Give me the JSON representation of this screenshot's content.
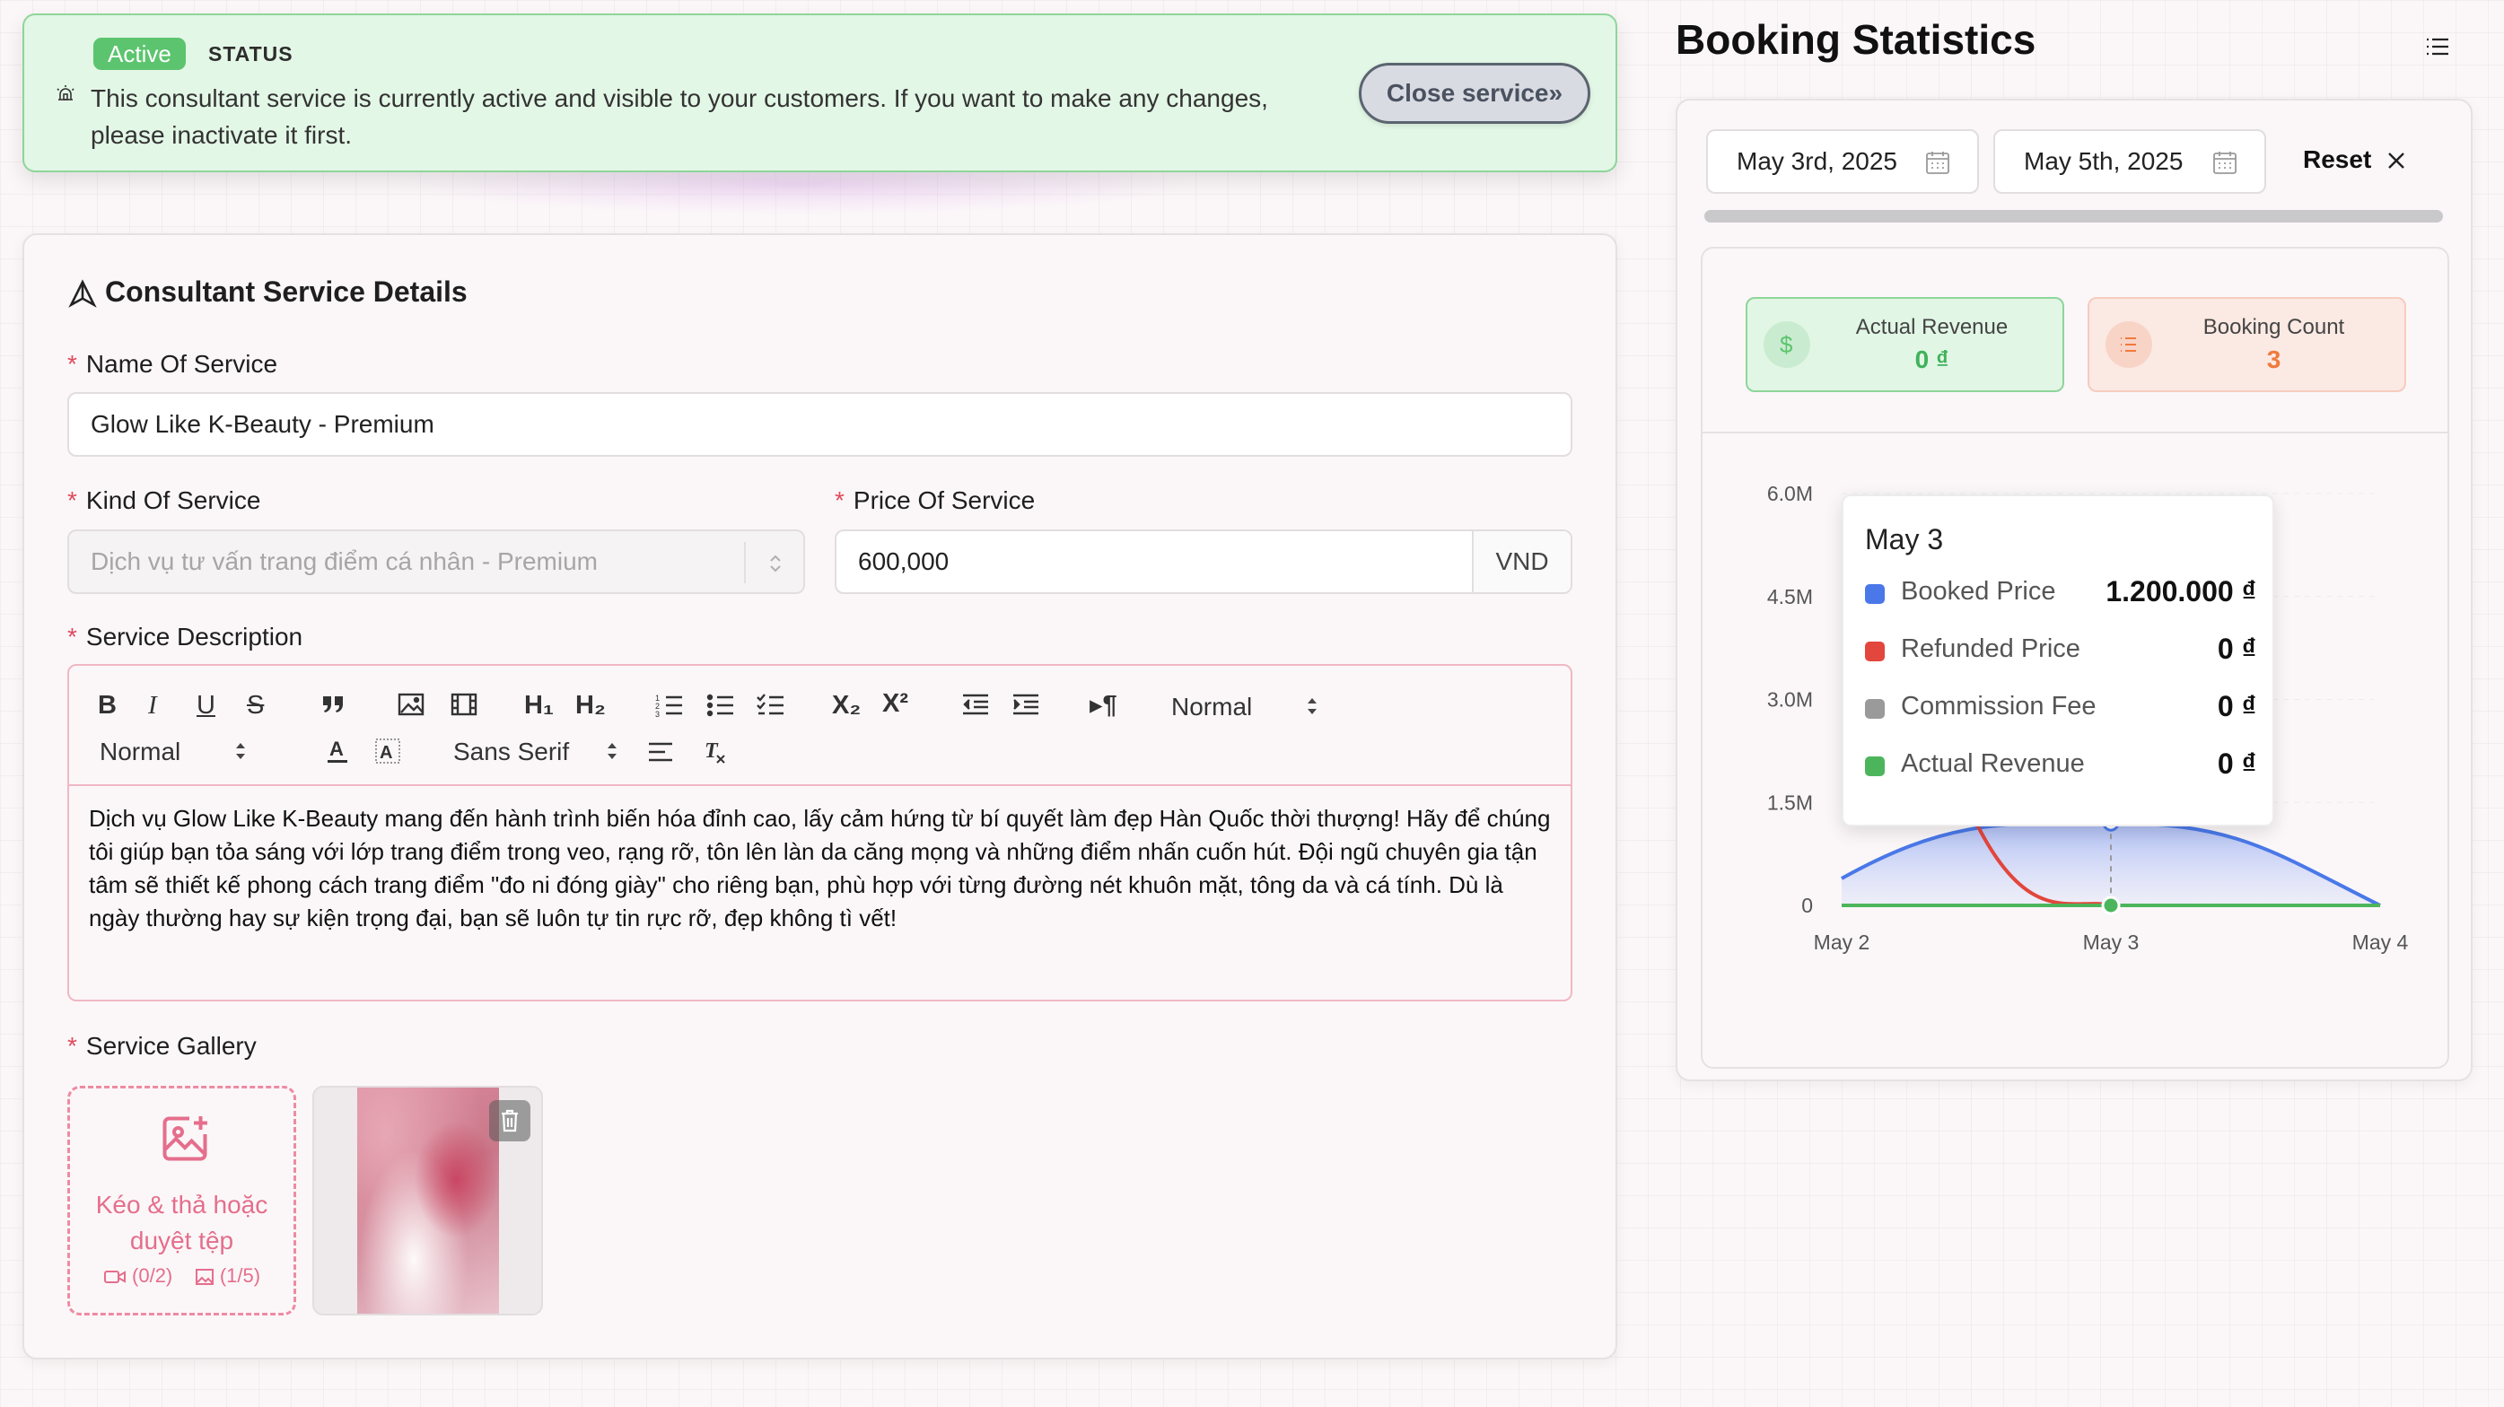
{
  "status_banner": {
    "badge": "Active",
    "label": "STATUS",
    "message": "This consultant service is currently active and visible to your customers. If you want to make any changes, please inactivate it first.",
    "close_button": "Close service»"
  },
  "details": {
    "title": "Consultant Service Details",
    "name_label": "Name Of Service",
    "name_value": "Glow Like K-Beauty - Premium",
    "kind_label": "Kind Of Service",
    "kind_value": "Dịch vụ tư vấn trang điểm cá nhân - Premium",
    "price_label": "Price Of Service",
    "price_value": "600,000",
    "price_currency": "VND",
    "description_label": "Service Description",
    "toolbar": {
      "header_select": "Normal",
      "size_select": "Normal",
      "font_select": "Sans Serif",
      "h1": "H₁",
      "h2": "H₂",
      "subscript": "X₂",
      "superscript": "X²"
    },
    "description": "Dịch vụ Glow Like K-Beauty mang đến hành trình biến hóa đỉnh cao, lấy cảm hứng từ bí quyết làm đẹp Hàn Quốc thời thượng! Hãy để chúng tôi giúp bạn tỏa sáng với lớp trang điểm trong veo, rạng rỡ, tôn lên làn da căng mọng và những điểm nhấn cuốn hút. Đội ngũ chuyên gia tận tâm sẽ thiết kế phong cách trang điểm \"đo ni đóng giày\" cho riêng bạn, phù hợp với từng đường nét khuôn mặt, tông da và cá tính. Dù là ngày thường hay sự kiện trọng đại, bạn sẽ luôn tự tin rực rỡ, đẹp không tì vết!",
    "gallery_label": "Service Gallery",
    "upload_text": "Kéo & thả hoặc duyệt tệp",
    "video_count": "(0/2)",
    "image_count": "(1/5)"
  },
  "stats": {
    "title": "Booking Statistics",
    "date_from": "May 3rd, 2025",
    "date_to": "May 5th, 2025",
    "reset": "Reset",
    "revenue_label": "Actual Revenue",
    "revenue_value": "0 ₫",
    "count_label": "Booking Count",
    "count_value": "3"
  },
  "tooltip": {
    "title": "May 3",
    "rows": [
      {
        "name": "Booked Price",
        "value": "1.200.000 ₫",
        "color": "#4a78e8"
      },
      {
        "name": "Refunded Price",
        "value": "0 ₫",
        "color": "#e2463c"
      },
      {
        "name": "Commission Fee",
        "value": "0 ₫",
        "color": "#9a9a9a"
      },
      {
        "name": "Actual Revenue",
        "value": "0 ₫",
        "color": "#4cb55c"
      }
    ]
  },
  "chart_data": {
    "type": "area",
    "categories": [
      "May 2",
      "May 3",
      "May 4"
    ],
    "y_ticks": [
      "0",
      "1.5M",
      "3.0M",
      "4.5M",
      "6.0M"
    ],
    "ylim": [
      0,
      6000000
    ],
    "series": [
      {
        "name": "Booked Price",
        "values": [
          0,
          1200000,
          0
        ],
        "color": "#4a78e8"
      },
      {
        "name": "Refunded Price",
        "values": [
          1200000,
          0,
          0
        ],
        "color": "#e2463c"
      },
      {
        "name": "Commission Fee",
        "values": [
          0,
          0,
          0
        ],
        "color": "#9a9a9a"
      },
      {
        "name": "Actual Revenue",
        "values": [
          0,
          0,
          0
        ],
        "color": "#4cb55c"
      }
    ]
  }
}
